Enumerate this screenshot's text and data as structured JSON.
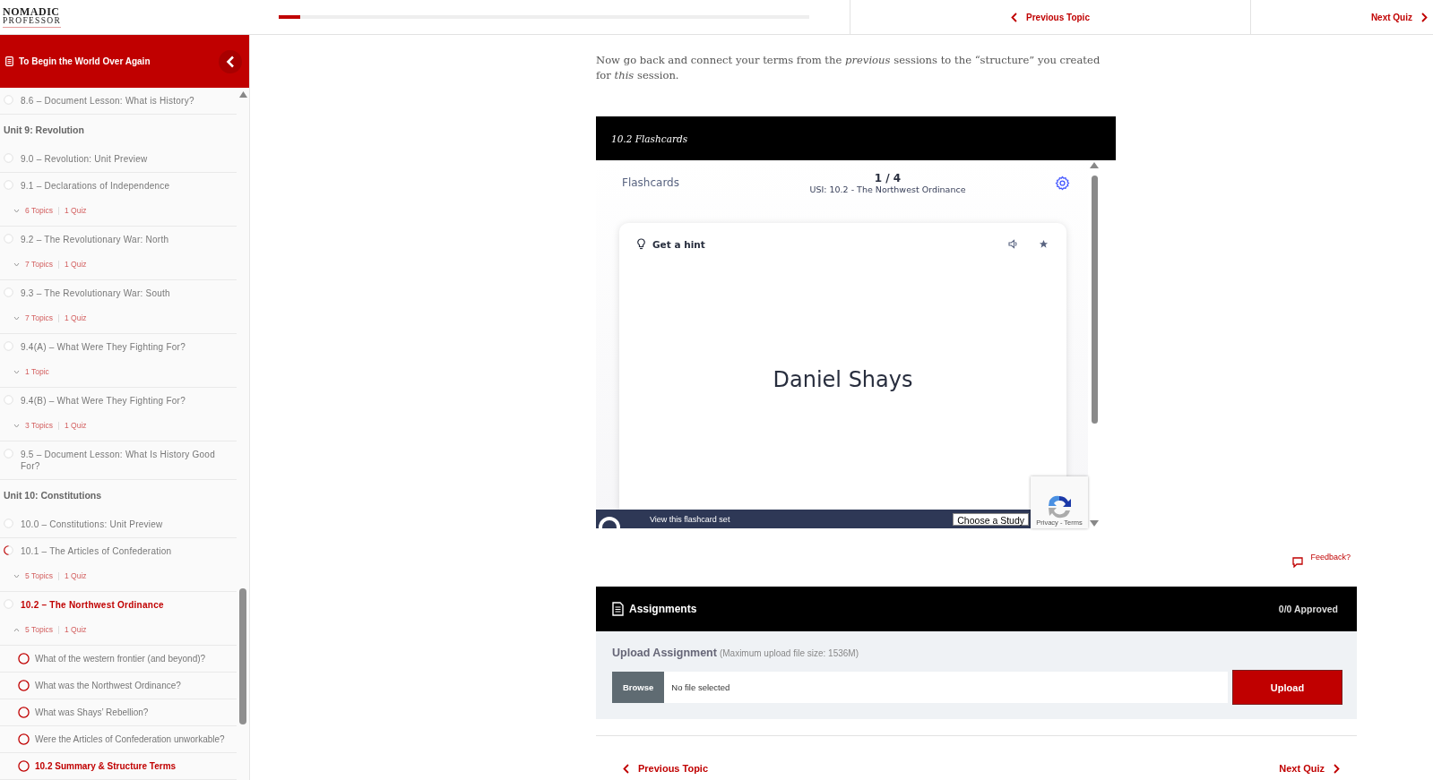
{
  "logo": {
    "line_1": "NOMADIC",
    "line_2": "PROFESSOR"
  },
  "top_bar": {
    "progress": {
      "level": 0.04
    },
    "previous": "Previous Topic",
    "next": "Next Quiz"
  },
  "sidebar": {
    "title": "To Begin the World Over Again",
    "items": [
      {
        "kind": "lesson",
        "label": "8.6 – Document Lesson: What is History?",
        "started": false,
        "current": false
      },
      {
        "kind": "unit",
        "label": "Unit 9: Revolution"
      },
      {
        "kind": "lesson",
        "label": "9.0 – Revolution: Unit Preview",
        "started": false,
        "current": false
      },
      {
        "kind": "lesson",
        "label": "9.1 – Declarations of Independence",
        "started": false,
        "current": false,
        "meta": {
          "expanded": false,
          "topics": "6 Topics",
          "quiz": "1 Quiz"
        }
      },
      {
        "kind": "lesson",
        "label": "9.2 – The Revolutionary War: North",
        "started": false,
        "current": false,
        "meta": {
          "expanded": false,
          "topics": "7 Topics",
          "quiz": "1 Quiz"
        }
      },
      {
        "kind": "lesson",
        "label": "9.3 – The Revolutionary War: South",
        "started": false,
        "current": false,
        "meta": {
          "expanded": false,
          "topics": "7 Topics",
          "quiz": "1 Quiz"
        }
      },
      {
        "kind": "lesson",
        "label": "9.4(A) – What Were They Fighting For?",
        "started": false,
        "current": false,
        "meta": {
          "expanded": false,
          "topics": "1 Topic"
        }
      },
      {
        "kind": "lesson",
        "label": "9.4(B) – What Were They Fighting For?",
        "started": false,
        "current": false,
        "meta": {
          "expanded": false,
          "topics": "3 Topics",
          "quiz": "1 Quiz"
        }
      },
      {
        "kind": "lesson",
        "label": "9.5 – Document Lesson: What Is History Good For?",
        "started": false,
        "current": false
      },
      {
        "kind": "unit",
        "label": "Unit 10: Constitutions"
      },
      {
        "kind": "lesson",
        "label": "10.0 – Constitutions: Unit Preview",
        "started": false,
        "current": false
      },
      {
        "kind": "lesson",
        "label": "10.1 – The Articles of Confederation",
        "started": true,
        "current": false,
        "meta": {
          "expanded": false,
          "topics": "5 Topics",
          "quiz": "1 Quiz"
        }
      },
      {
        "kind": "lesson",
        "label": "10.2 – The Northwest Ordinance",
        "started": false,
        "current": true,
        "meta": {
          "expanded": true,
          "topics": "5 Topics",
          "quiz": "1 Quiz"
        },
        "children": [
          {
            "label": "What of the western frontier (and beyond)?",
            "current": false
          },
          {
            "label": "What was the Northwest Ordinance?",
            "current": false
          },
          {
            "label": "What was Shays’ Rebellion?",
            "current": false
          },
          {
            "label": "Were the Articles of Confederation unworkable?",
            "current": false
          },
          {
            "label": "10.2 Summary & Structure Terms",
            "current": true
          }
        ]
      }
    ]
  },
  "intro": "Now go back and connect your terms from the *previous* sessions to the “structure” you created for *this* session.",
  "flashcards": {
    "title": "10.2 Flashcards",
    "heading": "Flashcards",
    "counter": "1 / 4",
    "set_name": "USI: 10.2 - The Northwest Ordinance",
    "hint": "Get a hint",
    "term": "Daniel Shays",
    "view_link": "View this flashcard set",
    "study_mode": "Choose a Study",
    "recaptcha": "Privacy - Terms"
  },
  "feedback": "Feedback?",
  "assignments": {
    "title": "Assignments",
    "approved": "0/0 Approved",
    "upload_title": "Upload Assignment",
    "upload_note": "(Maximum upload file size: 1536M)",
    "browse": "Browse",
    "file_placeholder": "No file selected",
    "upload": "Upload"
  },
  "bottom_nav": {
    "previous": "Previous Topic",
    "next": "Next Quiz"
  }
}
